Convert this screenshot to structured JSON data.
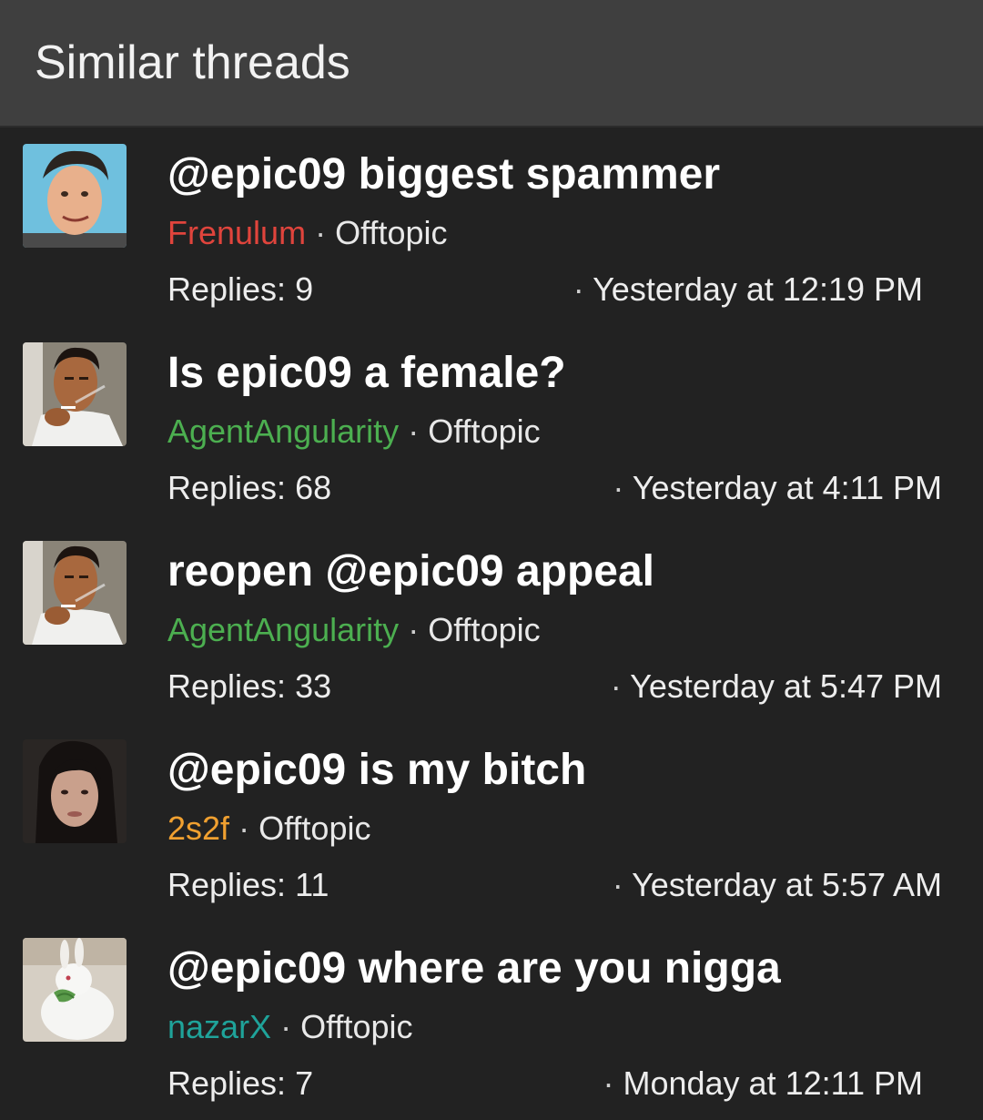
{
  "header": {
    "title": "Similar threads"
  },
  "threads": [
    {
      "title": "@epic09 biggest spammer",
      "author": "Frenulum",
      "author_color": "#e0443c",
      "forum": "Offtopic",
      "replies": "Replies: 9",
      "date": "Yesterday at 12:19 PM",
      "avatar": "man-portrait-blue-background"
    },
    {
      "title": "Is epic09 a female?",
      "author": "AgentAngularity",
      "author_color": "#4caf50",
      "forum": "Offtopic",
      "replies": "Replies: 68",
      "date": "Yesterday at 4:11 PM",
      "avatar": "man-smoking-cigarette"
    },
    {
      "title": "reopen @epic09 appeal",
      "author": "AgentAngularity",
      "author_color": "#4caf50",
      "forum": "Offtopic",
      "replies": "Replies: 33",
      "date": "Yesterday at 5:47 PM",
      "avatar": "man-smoking-cigarette"
    },
    {
      "title": "@epic09 is my bitch",
      "author": "2s2f",
      "author_color": "#f0a030",
      "forum": "Offtopic",
      "replies": "Replies: 11",
      "date": "Yesterday at 5:57 AM",
      "avatar": "woman-dark-hair"
    },
    {
      "title": "@epic09 where are you nigga",
      "author": "nazarX",
      "author_color": "#1fa39a",
      "forum": "Offtopic",
      "replies": "Replies: 7",
      "date": "Monday at 12:11 PM",
      "avatar": "white-rabbit"
    }
  ],
  "separator": "·"
}
